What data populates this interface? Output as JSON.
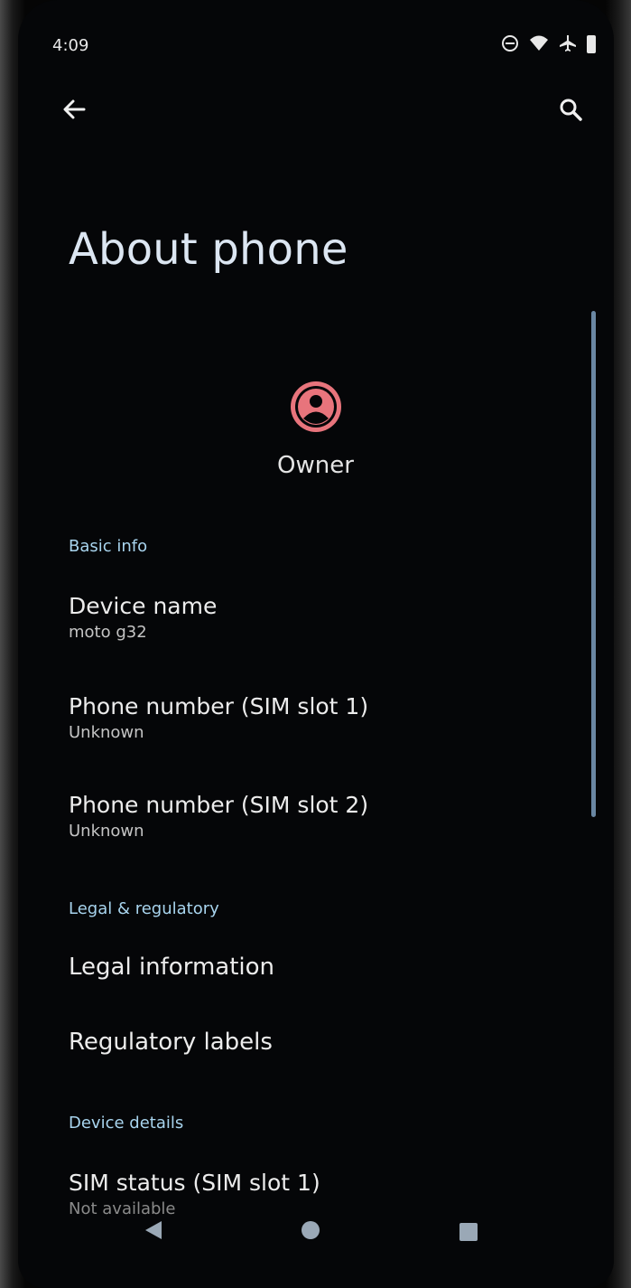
{
  "status_bar": {
    "time": "4:09",
    "icons": [
      "do-not-disturb-icon",
      "wifi-icon",
      "airplane-icon",
      "battery-icon"
    ]
  },
  "top_bar": {
    "back_icon": "back-arrow-icon",
    "search_icon": "search-icon"
  },
  "page_title": "About phone",
  "owner": {
    "icon": "account-circle-icon",
    "label": "Owner",
    "icon_color": "#e8747c"
  },
  "sections": {
    "basic_info": {
      "header": "Basic info",
      "items": [
        {
          "title": "Device name",
          "subtitle": "moto g32"
        },
        {
          "title": "Phone number (SIM slot 1)",
          "subtitle": "Unknown"
        },
        {
          "title": "Phone number (SIM slot 2)",
          "subtitle": "Unknown"
        }
      ]
    },
    "legal": {
      "header": "Legal & regulatory",
      "items": [
        {
          "title": "Legal information"
        },
        {
          "title": "Regulatory labels"
        }
      ]
    },
    "device_details": {
      "header": "Device details",
      "items": [
        {
          "title": "SIM status (SIM slot 1)",
          "subtitle": "Not available"
        }
      ]
    }
  },
  "nav_bar": {
    "back_icon": "nav-back-triangle-icon",
    "home_icon": "nav-home-circle-icon",
    "recents_icon": "nav-recents-square-icon"
  },
  "colors": {
    "background": "#050608",
    "section_header": "#a8d4ee",
    "title": "#dce6f2",
    "accent": "#e8747c"
  }
}
